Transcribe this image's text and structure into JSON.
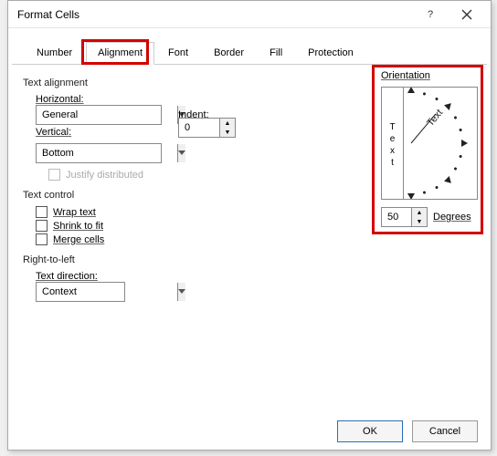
{
  "dialog": {
    "title": "Format Cells"
  },
  "tabs": {
    "number": "Number",
    "alignment": "Alignment",
    "font": "Font",
    "border": "Border",
    "fill": "Fill",
    "protection": "Protection"
  },
  "textAlignment": {
    "group": "Text alignment",
    "horizontal_label": "Horizontal:",
    "horizontal_value": "General",
    "indent_label": "Indent:",
    "indent_value": "0",
    "vertical_label": "Vertical:",
    "vertical_value": "Bottom",
    "justify_label": "Justify distributed"
  },
  "textControl": {
    "group": "Text control",
    "wrap": "Wrap text",
    "shrink": "Shrink to fit",
    "merge": "Merge cells"
  },
  "rtl": {
    "group": "Right-to-left",
    "direction_label": "Text direction:",
    "direction_value": "Context"
  },
  "orientation": {
    "group": "Orientation",
    "vertical_word": "Text",
    "angled_word": "Text",
    "degrees_label": "Degrees",
    "degrees_value": "50"
  },
  "buttons": {
    "ok": "OK",
    "cancel": "Cancel"
  },
  "highlight_color": "#d40000"
}
